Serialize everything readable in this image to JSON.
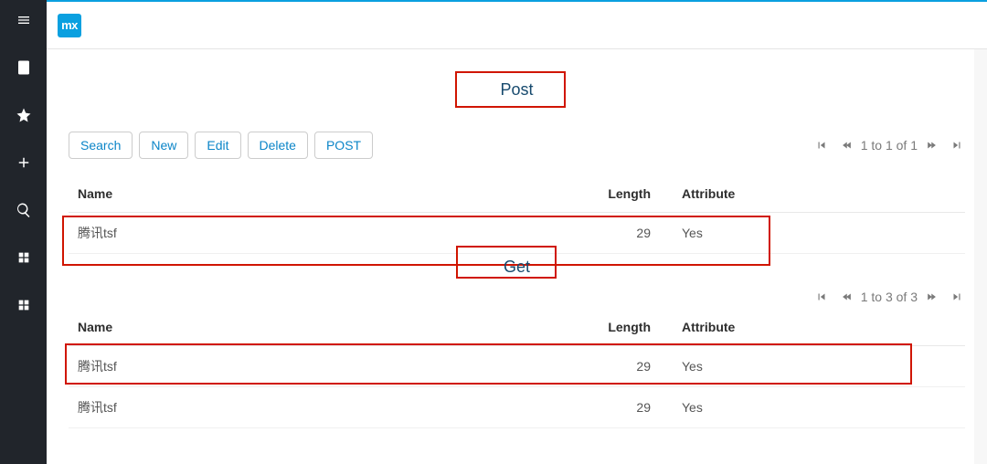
{
  "brand": {
    "logo_text": "mx"
  },
  "labels": {
    "post": "Post",
    "get": "Get"
  },
  "toolbar": {
    "search": "Search",
    "new": "New",
    "edit": "Edit",
    "delete": "Delete",
    "post": "POST"
  },
  "pager1": {
    "status": "1 to 1 of 1"
  },
  "pager2": {
    "status": "1 to 3 of 3"
  },
  "columns": {
    "name": "Name",
    "length": "Length",
    "attribute": "Attribute"
  },
  "table1": {
    "rows": [
      {
        "name": "腾讯tsf",
        "length": "29",
        "attribute": "Yes"
      }
    ]
  },
  "table2": {
    "rows": [
      {
        "name": "腾讯tsf",
        "length": "29",
        "attribute": "Yes"
      },
      {
        "name": "腾讯tsf",
        "length": "29",
        "attribute": "Yes"
      }
    ]
  }
}
